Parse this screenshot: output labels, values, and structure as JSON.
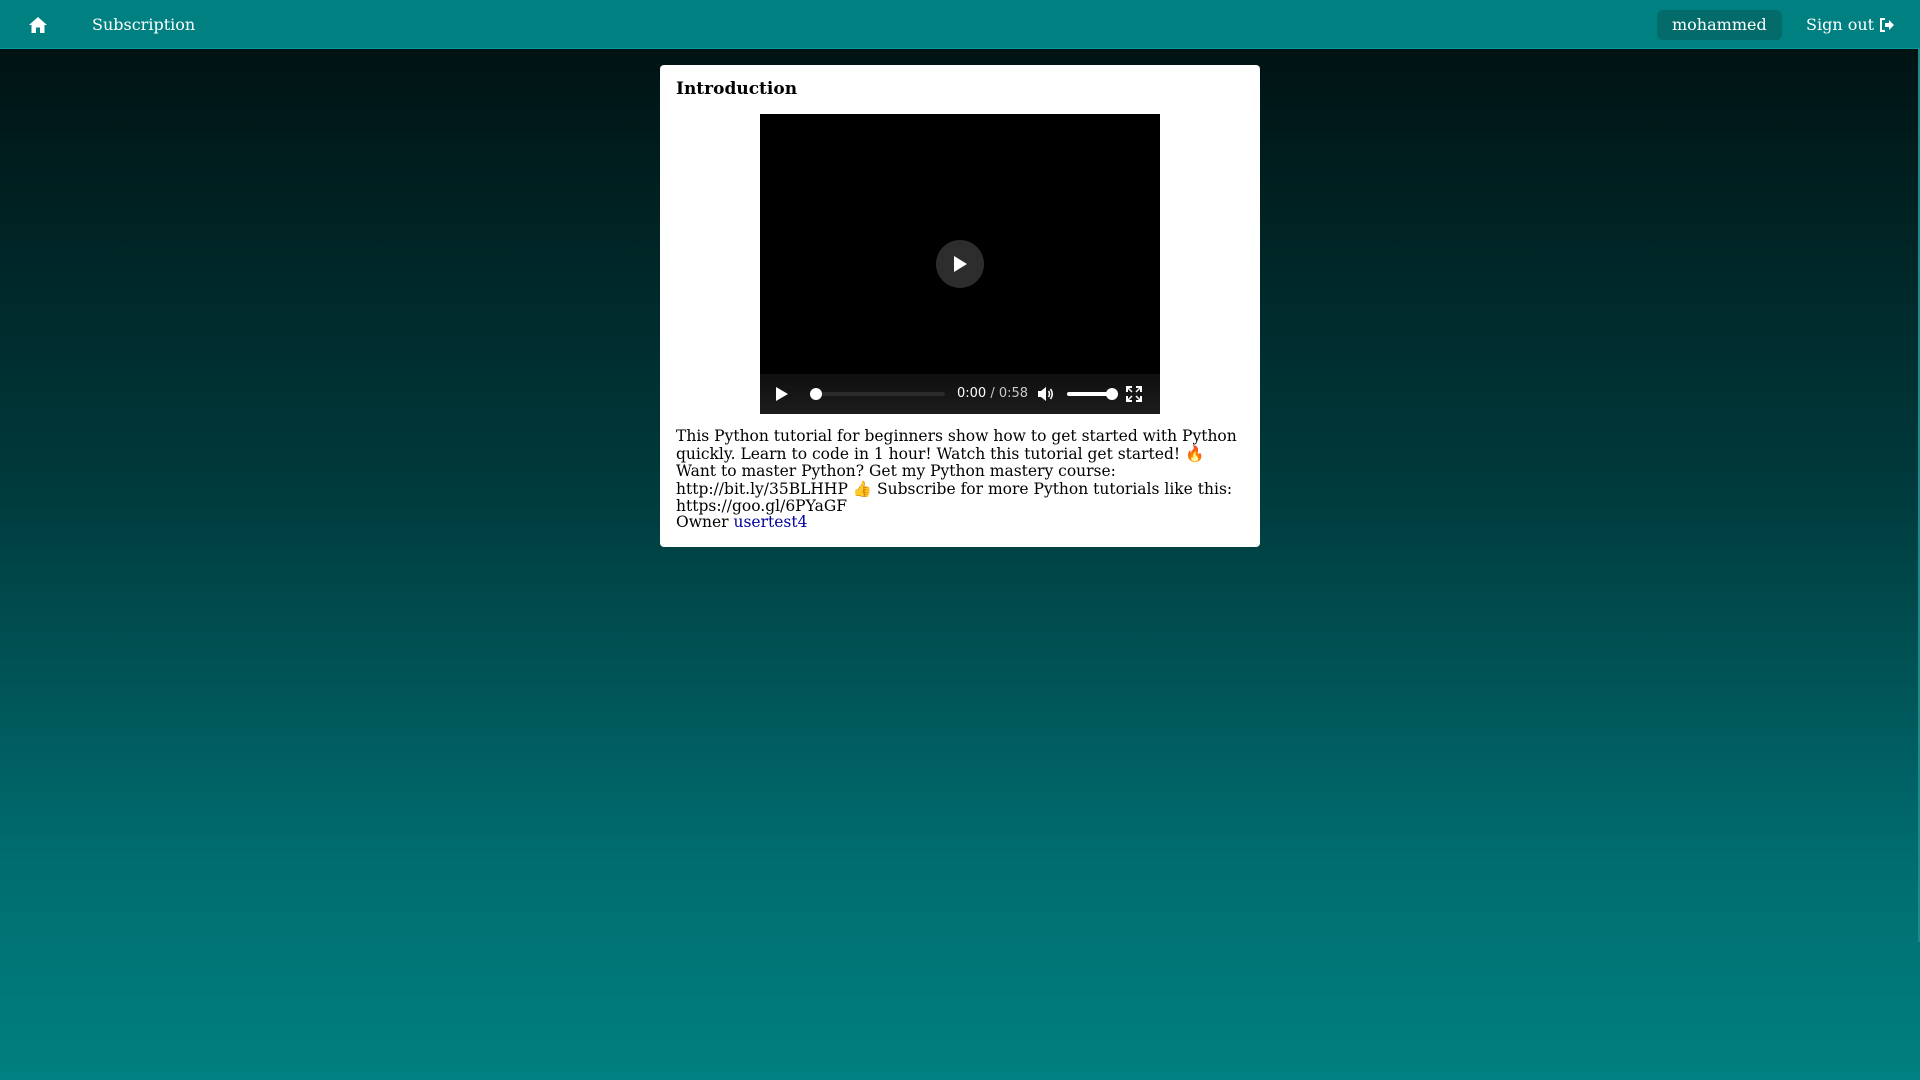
{
  "navbar": {
    "home_icon": "home-icon",
    "subscription_label": "Subscription",
    "username": "mohammed",
    "signout_label": "Sign out",
    "signout_icon": "sign-out-icon"
  },
  "video_card": {
    "title": "Introduction",
    "player": {
      "current_time": "0:00",
      "separator": "/",
      "duration": "0:58",
      "progress": 0.0,
      "volume": 1.0
    },
    "description": "This Python tutorial for beginners show how to get started with Python quickly. Learn to code in 1 hour! Watch this tutorial get started! 🔥 Want to master Python? Get my Python mastery course: http://bit.ly/35BLHHP 👍 Subscribe for more Python tutorials like this: https://goo.gl/6PYaGF",
    "owner_label": "Owner",
    "owner_name": "usertest4"
  },
  "colors": {
    "navbar": "#008080",
    "user_pill": "#046b6b",
    "link": "#0000a0"
  }
}
